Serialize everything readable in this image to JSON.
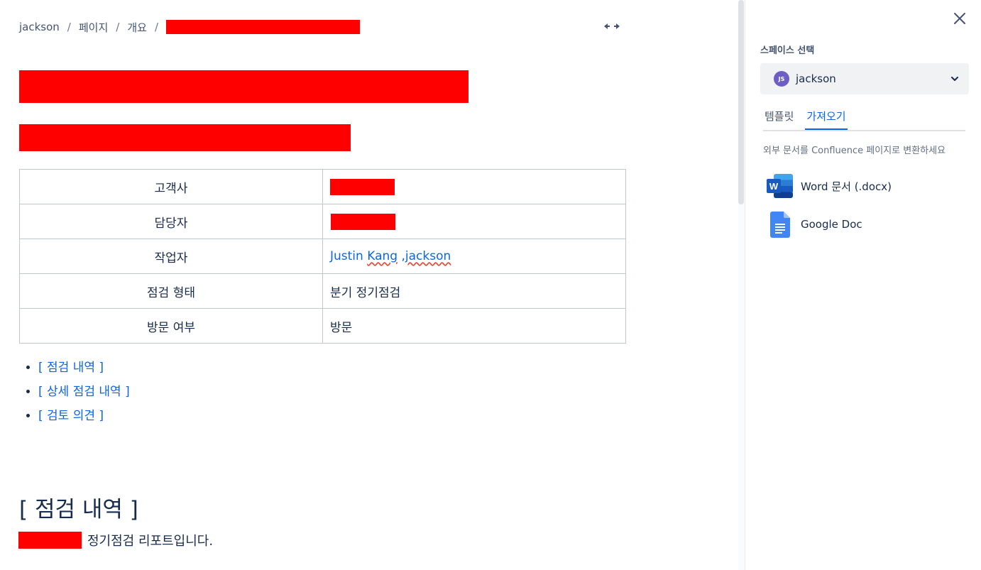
{
  "breadcrumb": {
    "items": [
      "jackson",
      "페이지",
      "개요"
    ],
    "separator": "/"
  },
  "info_table": {
    "rows": [
      {
        "label": "고객사",
        "value": ""
      },
      {
        "label": "담당자",
        "value": ""
      },
      {
        "label": "작업자",
        "value": "Justin Kang ,jackson",
        "name_first": "Justin ",
        "name_underlined": "Kang",
        "name_sep": " ,",
        "name_last": "jackson"
      },
      {
        "label": "점검 형태",
        "value": "분기 정기점검"
      },
      {
        "label": "방문 여부",
        "value": "방문"
      }
    ]
  },
  "toc": {
    "items": [
      "[ 점검 내역 ]",
      "[ 상세 점검 내역 ]",
      "[ 검토 의견 ]"
    ]
  },
  "section": {
    "heading": "[ 점검 내역 ]",
    "report_text": "정기점검 리포트입니다."
  },
  "panel": {
    "space_label": "스페이스 선택",
    "space_avatar": "JS",
    "space_name": "jackson",
    "tabs": [
      {
        "label": "템플릿",
        "active": false
      },
      {
        "label": "가져오기",
        "active": true
      }
    ],
    "import_description": "외부 문서를 Confluence 페이지로 변환하세요",
    "import_options": [
      {
        "label": "Word 문서 (.docx)",
        "icon": "word-icon",
        "icon_letter": "W"
      },
      {
        "label": "Google Doc",
        "icon": "google-doc-icon"
      }
    ]
  },
  "colors": {
    "link": "#0c66e4",
    "redaction": "#ff0000",
    "word": "#185abd",
    "google_doc": "#4285f4"
  }
}
